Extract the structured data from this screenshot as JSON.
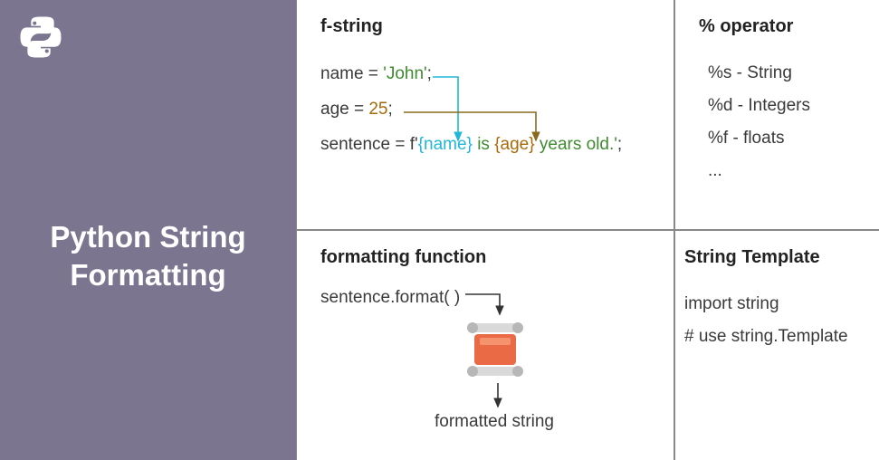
{
  "title": "Python String\nFormatting",
  "fstring": {
    "title": "f-string",
    "l1_pre": "name = ",
    "l1_str": "'John'",
    "l1_post": ";",
    "l2_pre": "age = ",
    "l2_num": "25",
    "l2_post": ";",
    "l3_pre": "sentence = f'",
    "l3_name": "{name}",
    "l3_mid": " is ",
    "l3_age": "{age}",
    "l3_tail": " years old.'",
    "l3_post": ";"
  },
  "operator": {
    "title": "% operator",
    "items": [
      "%s - String",
      "%d - Integers",
      "%f - floats",
      "..."
    ]
  },
  "formatfn": {
    "title": "formatting function",
    "call": "sentence.format( )",
    "output": "formatted string"
  },
  "template": {
    "title": "String Template",
    "lines": [
      "import string",
      "# use string.Template"
    ]
  }
}
